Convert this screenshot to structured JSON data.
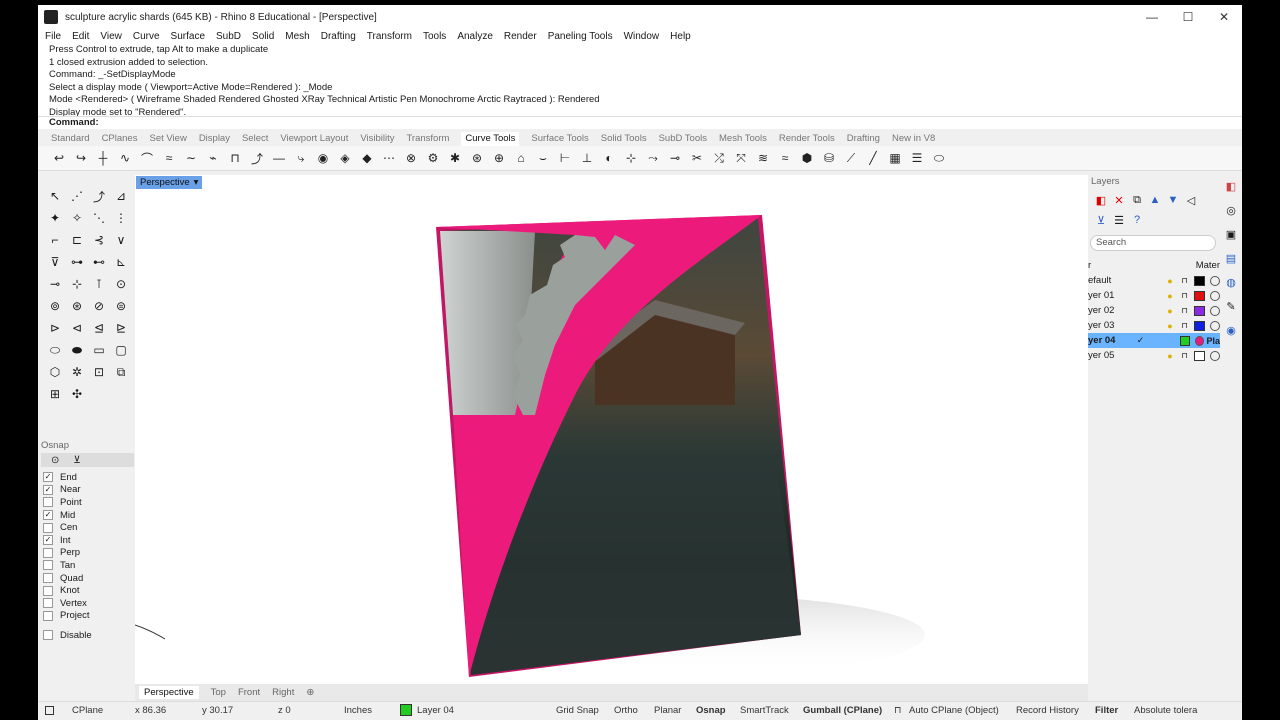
{
  "window": {
    "title": "sculpture acrylic shards (645 KB) - Rhino 8 Educational - [Perspective]",
    "controls": [
      "—",
      "☐",
      "✕"
    ]
  },
  "menu": [
    "File",
    "Edit",
    "View",
    "Curve",
    "Surface",
    "SubD",
    "Solid",
    "Mesh",
    "Drafting",
    "Transform",
    "Tools",
    "Analyze",
    "Render",
    "Paneling Tools",
    "Window",
    "Help"
  ],
  "command_history": [
    "Press Control to extrude, tap Alt to make a duplicate",
    "1 closed extrusion added to selection.",
    "Command: _-SetDisplayMode",
    "Select a display mode ( Viewport=Active  Mode=Rendered ): _Mode",
    "Mode <Rendered> ( Wireframe  Shaded  Rendered  Ghosted  XRay  Technical  Artistic  Pen  Monochrome  Arctic  Raytraced ): Rendered",
    "Display mode set to \"Rendered\"."
  ],
  "command_prompt": "Command:",
  "toolbar_tabs": [
    "Standard",
    "CPlanes",
    "Set View",
    "Display",
    "Select",
    "Viewport Layout",
    "Visibility",
    "Transform",
    "Curve Tools",
    "Surface Tools",
    "Solid Tools",
    "SubD Tools",
    "Mesh Tools",
    "Render Tools",
    "Drafting",
    "New in V8"
  ],
  "active_toolbar_tab": "Curve Tools",
  "viewport": {
    "label": "Perspective",
    "tabs": [
      "Perspective",
      "Top",
      "Front",
      "Right"
    ],
    "active_tab": "Perspective",
    "colors": {
      "panel_magenta": "#ec1b7b",
      "label_bg": "#6aa0e8"
    }
  },
  "osnap": {
    "title": "Osnap",
    "items": [
      {
        "label": "End",
        "checked": true
      },
      {
        "label": "Near",
        "checked": true
      },
      {
        "label": "Point",
        "checked": false
      },
      {
        "label": "Mid",
        "checked": true
      },
      {
        "label": "Cen",
        "checked": false
      },
      {
        "label": "Int",
        "checked": true
      },
      {
        "label": "Perp",
        "checked": false
      },
      {
        "label": "Tan",
        "checked": false
      },
      {
        "label": "Quad",
        "checked": false
      },
      {
        "label": "Knot",
        "checked": false
      },
      {
        "label": "Vertex",
        "checked": false
      },
      {
        "label": "Project",
        "checked": false
      }
    ],
    "disable_label": "Disable"
  },
  "layers": {
    "title": "Layers",
    "search_placeholder": "Search",
    "header_left": "r",
    "header_right": "Mater",
    "rows": [
      {
        "name": "efault",
        "color": "#000000",
        "current": false,
        "material": ""
      },
      {
        "name": "yer 01",
        "color": "#e01010",
        "current": false,
        "material": ""
      },
      {
        "name": "yer 02",
        "color": "#8a2be2",
        "current": false,
        "material": ""
      },
      {
        "name": "yer 03",
        "color": "#1020e0",
        "current": false,
        "material": ""
      },
      {
        "name": "yer 04",
        "color": "#22cc22",
        "current": true,
        "material": "Pla"
      },
      {
        "name": "yer 05",
        "color": "#ffffff",
        "current": false,
        "material": ""
      }
    ]
  },
  "status": {
    "cplane": "CPlane",
    "x": "x 86.36",
    "y": "y 30.17",
    "z": "z 0",
    "units": "Inches",
    "layer": "Layer 04",
    "layer_color": "#22cc22",
    "grid_snap": "Grid Snap",
    "ortho": "Ortho",
    "planar": "Planar",
    "osnap": "Osnap",
    "smarttrack": "SmartTrack",
    "gumball": "Gumball (CPlane)",
    "auto_cplane": "Auto CPlane (Object)",
    "record_history": "Record History",
    "filter": "Filter",
    "tolerance": "Absolute tolera"
  }
}
